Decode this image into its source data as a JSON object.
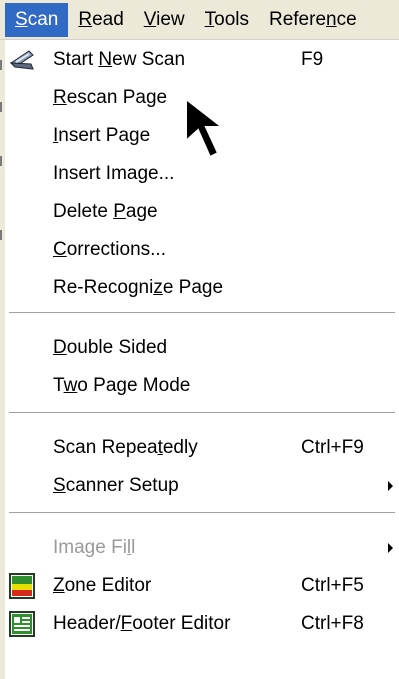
{
  "menubar": {
    "items": [
      {
        "label": "Scan",
        "accel": "S"
      },
      {
        "label": "Read",
        "accel": "R"
      },
      {
        "label": "View",
        "accel": "V"
      },
      {
        "label": "Tools",
        "accel": "T"
      },
      {
        "label": "Reference",
        "accel": "n"
      }
    ]
  },
  "scan_menu": {
    "items": [
      {
        "label": "Start New Scan",
        "shortcut": "F9",
        "icon": "scanner-icon",
        "enabled": true
      },
      {
        "label": "Rescan Page",
        "enabled": true
      },
      {
        "label": "Insert Page",
        "enabled": true
      },
      {
        "label": "Insert Image...",
        "enabled": true
      },
      {
        "label": "Delete Page",
        "enabled": true
      },
      {
        "label": "Corrections...",
        "enabled": true
      },
      {
        "label": "Re-Recognize Page",
        "enabled": true
      },
      {
        "label": "Double Sided",
        "enabled": true
      },
      {
        "label": "Two Page Mode",
        "enabled": true
      },
      {
        "label": "Scan Repeatedly",
        "shortcut": "Ctrl+F9",
        "enabled": true
      },
      {
        "label": "Scanner Setup",
        "submenu": true,
        "enabled": true
      },
      {
        "label": "Image Fill",
        "submenu": true,
        "enabled": false
      },
      {
        "label": "Zone Editor",
        "shortcut": "Ctrl+F5",
        "icon": "zone-editor-icon",
        "enabled": true
      },
      {
        "label": "Header/Footer Editor",
        "shortcut": "Ctrl+F8",
        "icon": "header-footer-editor-icon",
        "enabled": true
      }
    ]
  },
  "colors": {
    "menubar_bg": "#ece9d8",
    "highlight": "#316ac5",
    "disabled_text": "#9a9a9a"
  }
}
